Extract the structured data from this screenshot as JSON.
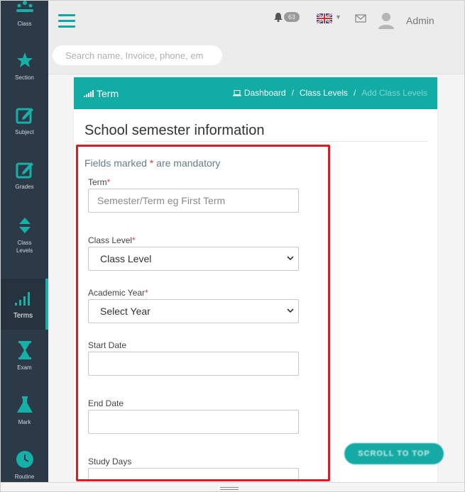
{
  "colors": {
    "accent": "#12aca4",
    "sidebar": "#2c3a47",
    "highlight": "#e8161d",
    "required": "#e03c3c"
  },
  "sidebar": {
    "items": [
      {
        "label": "Class",
        "icon": "class-icon"
      },
      {
        "label": "Section",
        "icon": "star-icon"
      },
      {
        "label": "Subject",
        "icon": "edit-icon"
      },
      {
        "label": "Grades",
        "icon": "edit-icon"
      },
      {
        "label": "Class\nLevels",
        "icon": "sort-arrows-icon"
      },
      {
        "label": "Terms",
        "icon": "signal-bars-icon",
        "active": true
      },
      {
        "label": "Exam",
        "icon": "hourglass-icon"
      },
      {
        "label": "Mark",
        "icon": "flask-icon"
      },
      {
        "label": "Routine",
        "icon": "clock-icon"
      }
    ]
  },
  "topbar": {
    "search_placeholder": "Search name, Invoice, phone, em",
    "notification_count": "63",
    "user_name": "Admin"
  },
  "card": {
    "header_title": "Term",
    "breadcrumb": {
      "dashboard": "Dashboard",
      "class_levels": "Class Levels",
      "current": "Add Class Levels",
      "separator": "/"
    },
    "title": "School semester information"
  },
  "form": {
    "mandatory_prefix": "Fields marked",
    "mandatory_star": "*",
    "mandatory_suffix": "are mandatory",
    "term_label": "Term",
    "term_placeholder": "Semester/Term eg First Term",
    "class_level_label": "Class Level",
    "class_level_value": "Class Level",
    "academic_year_label": "Academic Year",
    "academic_year_value": "Select Year",
    "start_date_label": "Start Date",
    "end_date_label": "End Date",
    "study_days_label": "Study Days",
    "required_star": "*"
  },
  "scroll_top_label": "SCROLL TO TOP"
}
